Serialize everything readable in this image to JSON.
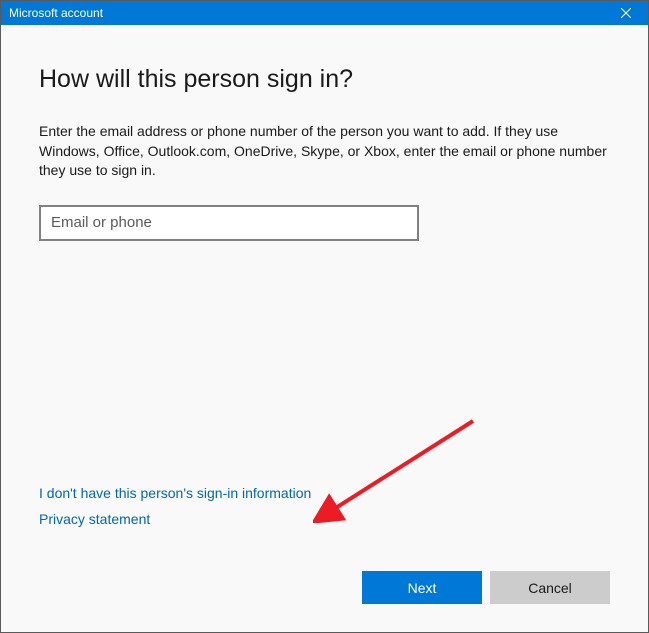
{
  "titlebar": {
    "title": "Microsoft account"
  },
  "main": {
    "heading": "How will this person sign in?",
    "description": "Enter the email address or phone number of the person you want to add. If they use Windows, Office, Outlook.com, OneDrive, Skype, or Xbox, enter the email or phone number they use to sign in.",
    "input_placeholder": "Email or phone",
    "input_value": ""
  },
  "links": {
    "no_info": "I don't have this person's sign-in information",
    "privacy": "Privacy statement"
  },
  "buttons": {
    "next": "Next",
    "cancel": "Cancel"
  }
}
